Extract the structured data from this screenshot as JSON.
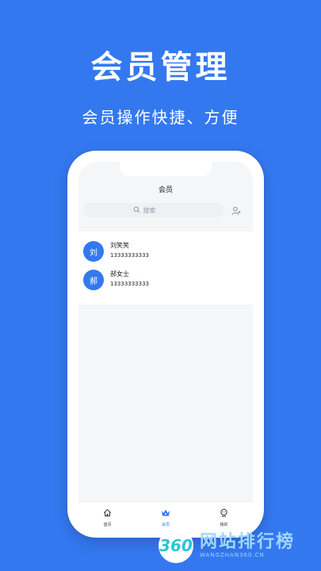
{
  "headline": "会员管理",
  "subline": "会员操作快捷、方便",
  "screen": {
    "nav_title": "会员",
    "search": {
      "placeholder": "搜索"
    },
    "members": [
      {
        "avatar": "刘",
        "name": "刘笑笑",
        "phone": "13333333333"
      },
      {
        "avatar": "郝",
        "name": "郝女士",
        "phone": "13333333333"
      }
    ],
    "tabs": [
      {
        "label": "首页",
        "icon": "home-icon"
      },
      {
        "label": "会员",
        "icon": "crown-icon",
        "active": true
      },
      {
        "label": "我的",
        "icon": "user-icon"
      }
    ]
  },
  "watermark": {
    "logo": "360",
    "main": "网站排行榜",
    "sub": "WANGZHAN360.CN"
  },
  "colors": {
    "accent": "#3478f0",
    "background": "#3478f0"
  }
}
